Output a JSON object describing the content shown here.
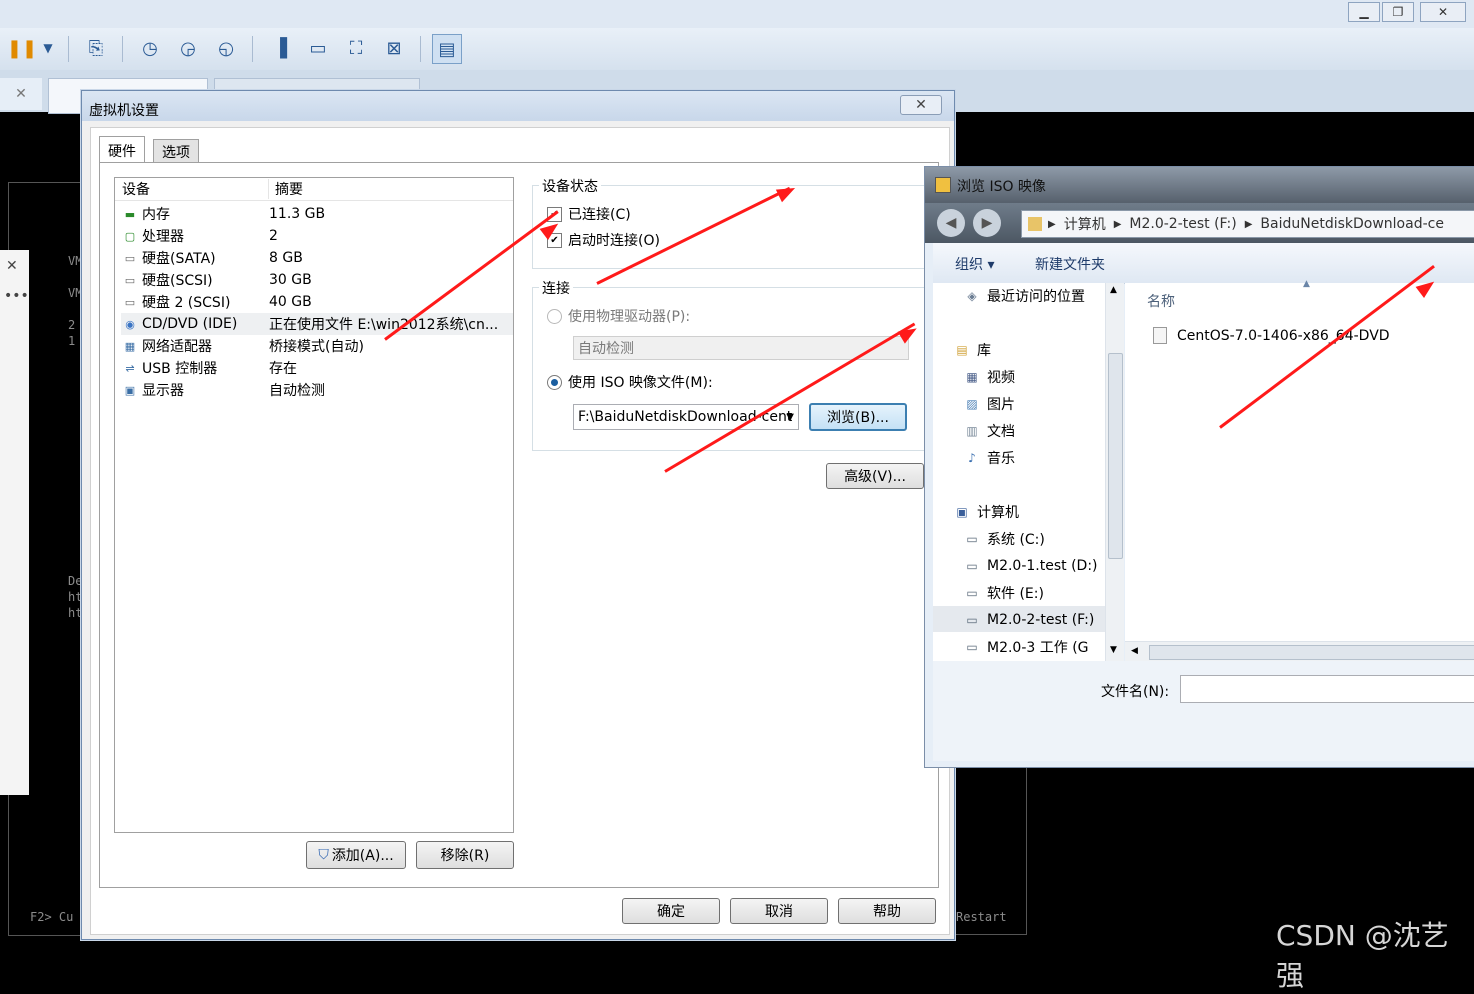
{
  "app": {
    "window_controls": {
      "minimize": "▁",
      "restore": "❐",
      "close": "✕"
    },
    "tab_close": "✕"
  },
  "console": {
    "lines": [
      "VM",
      "VM",
      "2",
      "1",
      "De",
      "ht",
      "ht"
    ],
    "bottom_left": "F2> Cu",
    "bottom_right": "Restart"
  },
  "vm_settings": {
    "title": "虚拟机设置",
    "close": "✕",
    "tabs": [
      {
        "label": "硬件"
      },
      {
        "label": "选项"
      }
    ],
    "device_list": {
      "headers": {
        "device": "设备",
        "summary": "摘要"
      },
      "rows": [
        {
          "icon": "memory-icon",
          "name": "内存",
          "summary": "11.3 GB"
        },
        {
          "icon": "cpu-icon",
          "name": "处理器",
          "summary": "2"
        },
        {
          "icon": "disk-icon",
          "name": "硬盘(SATA)",
          "summary": "8 GB"
        },
        {
          "icon": "disk-icon",
          "name": "硬盘(SCSI)",
          "summary": "30 GB"
        },
        {
          "icon": "disk-icon",
          "name": "硬盘 2 (SCSI)",
          "summary": "40 GB"
        },
        {
          "icon": "cd-icon",
          "name": "CD/DVD (IDE)",
          "summary": "正在使用文件 E:\\win2012系统\\cn..."
        },
        {
          "icon": "network-icon",
          "name": "网络适配器",
          "summary": "桥接模式(自动)"
        },
        {
          "icon": "usb-icon",
          "name": "USB 控制器",
          "summary": "存在"
        },
        {
          "icon": "monitor-icon",
          "name": "显示器",
          "summary": "自动检测"
        }
      ]
    },
    "device_status": {
      "title": "设备状态",
      "connected": {
        "label": "已连接(C)",
        "checked": true
      },
      "connect_at_power_on": {
        "label": "启动时连接(O)",
        "checked": true
      }
    },
    "connection": {
      "title": "连接",
      "physical": {
        "label": "使用物理驱动器(P):",
        "value": "自动检测"
      },
      "iso": {
        "label": "使用 ISO 映像文件(M):",
        "value": "F:\\BaiduNetdiskDownload-cent"
      },
      "browse_label": "浏览(B)...",
      "advanced_label": "高级(V)..."
    },
    "add_label": "添加(A)...",
    "remove_label": "移除(R)",
    "ok_label": "确定",
    "cancel_label": "取消",
    "help_label": "帮助"
  },
  "iso_browse": {
    "title": "浏览 ISO 映像",
    "breadcrumb": [
      "计算机",
      "M2.0-2-test (F:)",
      "BaiduNetdiskDownload-ce"
    ],
    "organize_label": "组织 ▾",
    "new_folder_label": "新建文件夹",
    "nav_items": [
      {
        "icon": "recent-icon",
        "label": "最近访问的位置"
      },
      {
        "icon": "library-icon",
        "label": "库"
      },
      {
        "icon": "video-icon",
        "label": "视频"
      },
      {
        "icon": "picture-icon",
        "label": "图片"
      },
      {
        "icon": "document-icon",
        "label": "文档"
      },
      {
        "icon": "music-icon",
        "label": "音乐"
      },
      {
        "icon": "computer-icon",
        "label": "计算机"
      },
      {
        "icon": "drive-icon",
        "label": "系统 (C:)"
      },
      {
        "icon": "drive-icon",
        "label": "M2.0-1.test (D:)"
      },
      {
        "icon": "drive-icon",
        "label": "软件 (E:)"
      },
      {
        "icon": "drive-icon",
        "label": "M2.0-2-test (F:)"
      },
      {
        "icon": "drive-icon",
        "label": "M2.0-3 工作 (G"
      }
    ],
    "column_header": "名称",
    "files": [
      {
        "name": "CentOS-7.0-1406-x86_64-DVD"
      }
    ],
    "filename_label": "文件名(N):",
    "filename_value": ""
  },
  "watermark": "CSDN @沈艺强",
  "annotation_color": "#ff1a1a"
}
